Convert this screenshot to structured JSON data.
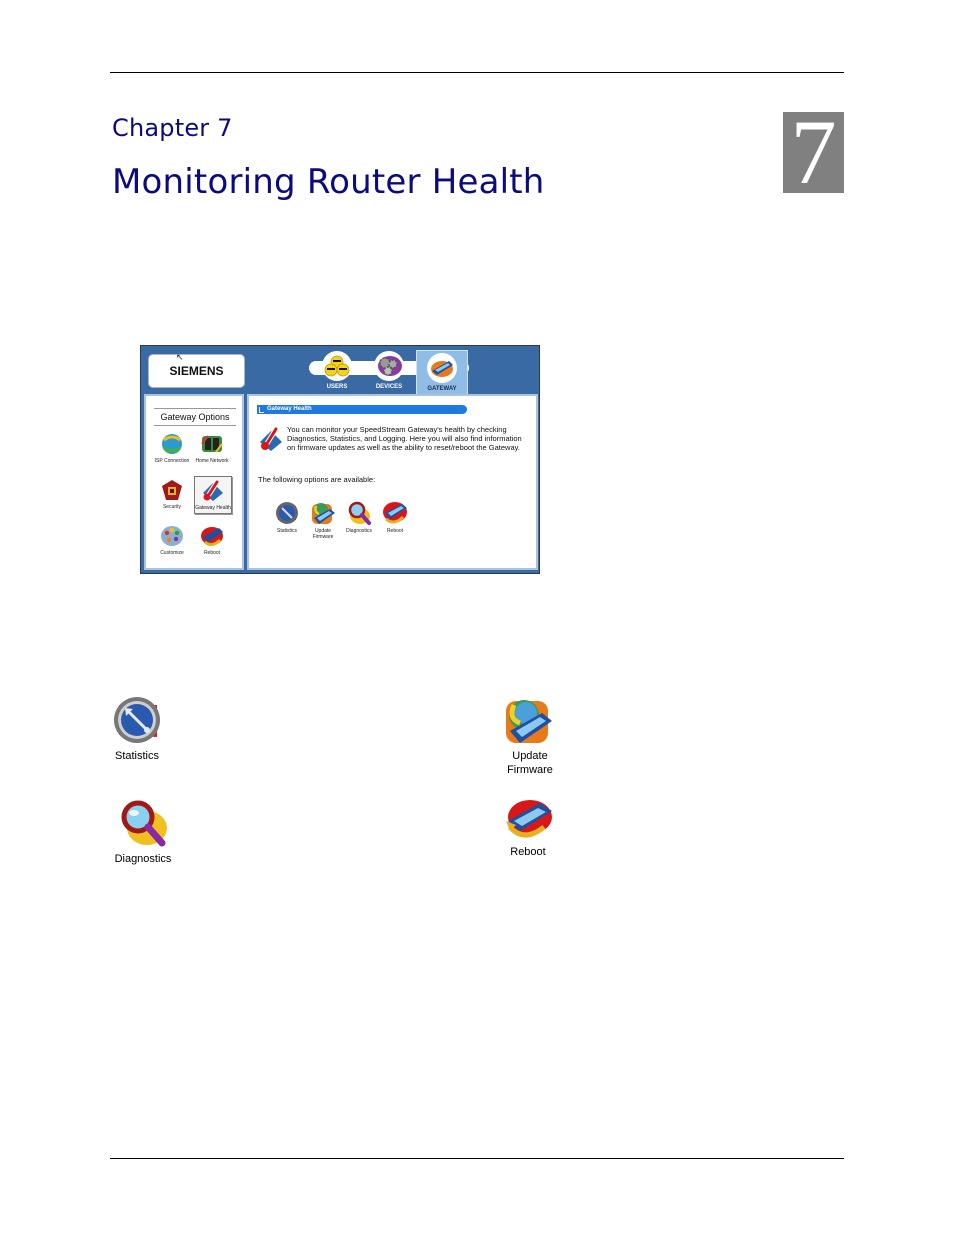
{
  "chapter": {
    "label": "Chapter 7",
    "title": "Monitoring Router Health",
    "number": "7"
  },
  "screenshot": {
    "brand": "SIEMENS",
    "nav_tabs": [
      {
        "label": "USERS",
        "icon": "users-icon",
        "active": false
      },
      {
        "label": "DEVICES",
        "icon": "devices-gears-icon",
        "active": false
      },
      {
        "label": "GATEWAY",
        "icon": "gateway-icon",
        "active": true
      }
    ],
    "left_panel": {
      "title": "Gateway Options",
      "items": [
        {
          "label": "ISP Connection",
          "icon": "isp-connection-icon",
          "selected": false
        },
        {
          "label": "Home Network",
          "icon": "home-network-icon",
          "selected": false
        },
        {
          "label": "Security",
          "icon": "security-icon",
          "selected": false
        },
        {
          "label": "Gateway Health",
          "icon": "gateway-health-icon",
          "selected": true
        },
        {
          "label": "Customize",
          "icon": "customize-palette-icon",
          "selected": false
        },
        {
          "label": "Reboot",
          "icon": "reboot-icon",
          "selected": false
        }
      ]
    },
    "right_panel": {
      "header": "Gateway Health",
      "description": "You can monitor your SpeedStream Gateway's health by checking Diagnostics, Statistics, and Logging. Here you will also find information on firmware updates as well as the ability to reset/reboot the Gateway.",
      "available_label": "The following options are available:",
      "options": [
        {
          "label": "Statistics",
          "icon": "statistics-gauge-icon"
        },
        {
          "label": "Update Firmware",
          "icon": "update-firmware-icon"
        },
        {
          "label": "Diagnostics",
          "icon": "diagnostics-magnifier-icon"
        },
        {
          "label": "Reboot",
          "icon": "reboot-icon"
        }
      ]
    }
  },
  "options": [
    {
      "label": "Statistics",
      "icon": "statistics-gauge-icon"
    },
    {
      "label": "Update Firmware",
      "icon": "update-firmware-icon"
    },
    {
      "label": "Diagnostics",
      "icon": "diagnostics-magnifier-icon"
    },
    {
      "label": "Reboot",
      "icon": "reboot-icon"
    }
  ],
  "colors": {
    "heading": "#0b0b7e",
    "chapter_box": "#808080",
    "ui_frame": "#3a6aa4",
    "ui_header_bar": "#1f7ae0"
  }
}
